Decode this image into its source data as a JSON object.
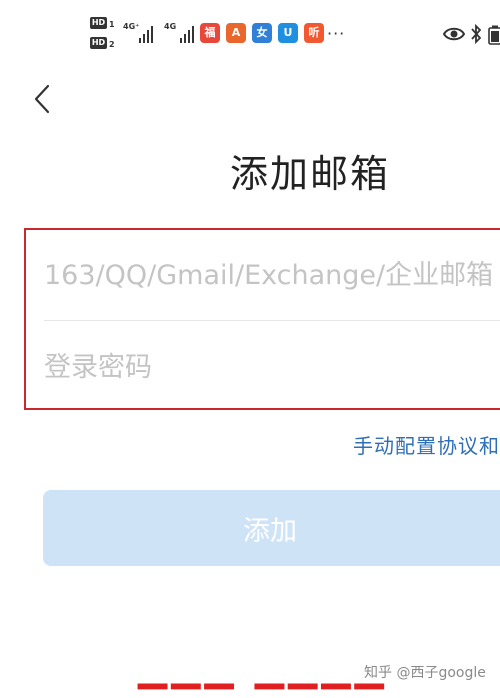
{
  "status_bar": {
    "hd1": "HD",
    "hd1_sub": "1",
    "hd2": "HD",
    "hd2_sub": "2",
    "signal1_net": "4G⁺",
    "signal2_net": "4G",
    "more": "···",
    "app_icons": [
      {
        "name": "lucky-app-icon",
        "glyph": "福",
        "color": "#e8483b"
      },
      {
        "name": "alipay-red-app-icon",
        "glyph": "A",
        "color": "#e9672c"
      },
      {
        "name": "lady-app-icon",
        "glyph": "女",
        "color": "#2f80d6"
      },
      {
        "name": "shield-app-icon",
        "glyph": "U",
        "color": "#1f8fe0"
      },
      {
        "name": "listen-app-icon",
        "glyph": "听",
        "color": "#f15a30"
      }
    ],
    "eye_icon": "eye-icon",
    "bluetooth_icon": "bluetooth-icon",
    "battery_icon": "battery-icon"
  },
  "nav": {
    "back_icon": "chevron-left-icon",
    "title": "添加邮箱"
  },
  "form": {
    "email_placeholder": "163/QQ/Gmail/Exchange/企业邮箱",
    "email_value": "",
    "password_placeholder": "登录密码",
    "password_value": "",
    "highlight_color": "#c8282e"
  },
  "manual_config_label": "手动配置协议和",
  "add_button_label": "添加",
  "watermark": "知乎 @西子google",
  "colors": {
    "link": "#2f6fb8",
    "button_disabled": "#cfe3f7",
    "annotation_red": "#e02020"
  }
}
